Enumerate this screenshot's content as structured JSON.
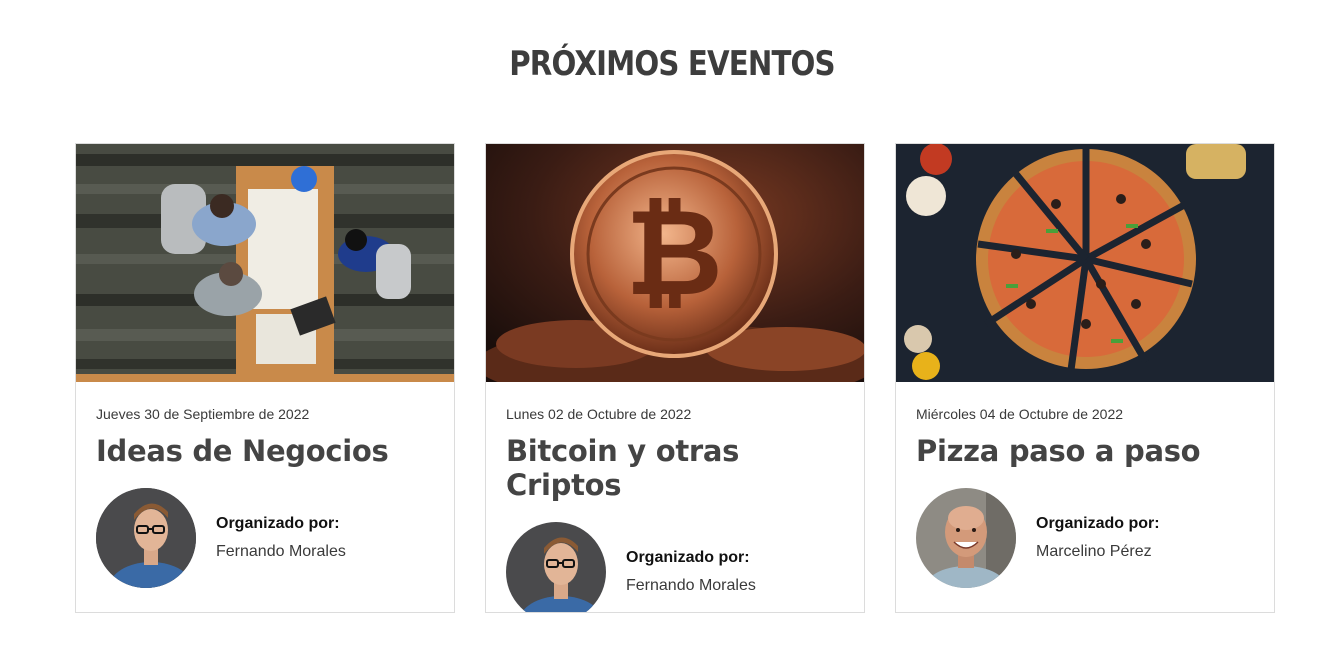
{
  "section": {
    "title": "PRÓXIMOS EVENTOS"
  },
  "events": [
    {
      "date": "Jueves 30 de Septiembre de 2022",
      "title": "Ideas de Negocios",
      "organizer_label": "Organizado por:",
      "organizer_name": "Fernando Morales",
      "image": "business-meeting-photo",
      "avatar": "man-glasses-portrait"
    },
    {
      "date": "Lunes 02 de Octubre de 2022",
      "title": "Bitcoin y otras Criptos",
      "organizer_label": "Organizado por:",
      "organizer_name": "Fernando Morales",
      "image": "bitcoin-coin-photo",
      "avatar": "man-glasses-portrait"
    },
    {
      "date": "Miércoles 04 de Octubre de 2022",
      "title": "Pizza paso a paso",
      "organizer_label": "Organizado por:",
      "organizer_name": "Marcelino Pérez",
      "image": "pizza-photo",
      "avatar": "bald-man-portrait"
    }
  ]
}
